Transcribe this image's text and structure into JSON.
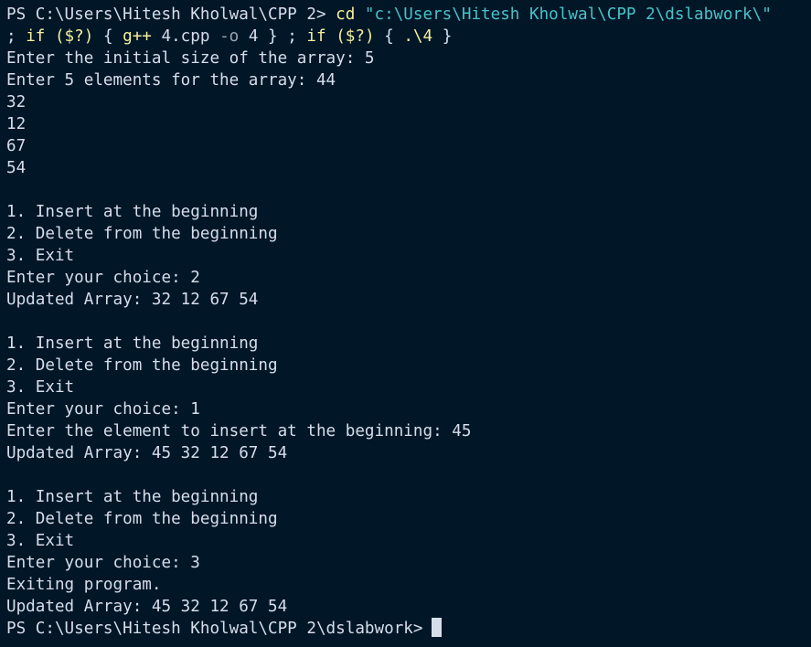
{
  "colors": {
    "background": "#011627",
    "foreground": "#d6deeb",
    "keyword": "#f4f19c",
    "string": "#46c2c8",
    "symbol": "#cfe8f2",
    "flag": "#9aa7b4"
  },
  "terminal": {
    "command": {
      "prompt": "PS C:\\Users\\Hitesh Kholwal\\CPP 2> ",
      "cd_kw": "cd",
      "path_str": "\"c:\\Users\\Hitesh Kholwal\\CPP 2\\dslabwork\\\"",
      "l2_semi1": ";",
      "l2_if1": "if",
      "l2_cond1": "($?)",
      "l2_brace1": "{",
      "l2_gpp": "g++",
      "l2_file": "4.cpp",
      "l2_flag": "-o",
      "l2_out": "4",
      "l2_close1": "}",
      "l2_semi2": ";",
      "l2_if2": "if",
      "l2_cond2": "($?)",
      "l2_brace2": "{",
      "l2_run": ".\\4",
      "l2_close2": "}"
    },
    "output_lines": [
      "Enter the initial size of the array: 5",
      "Enter 5 elements for the array: 44",
      "32",
      "12",
      "67",
      "54",
      "",
      "1. Insert at the beginning",
      "2. Delete from the beginning",
      "3. Exit",
      "Enter your choice: 2",
      "Updated Array: 32 12 67 54",
      "",
      "1. Insert at the beginning",
      "2. Delete from the beginning",
      "3. Exit",
      "Enter your choice: 1",
      "Enter the element to insert at the beginning: 45",
      "Updated Array: 45 32 12 67 54",
      "",
      "1. Insert at the beginning",
      "2. Delete from the beginning",
      "3. Exit",
      "Enter your choice: 3",
      "Exiting program.",
      "Updated Array: 45 32 12 67 54"
    ],
    "final_prompt": "PS C:\\Users\\Hitesh Kholwal\\CPP 2\\dslabwork>"
  }
}
